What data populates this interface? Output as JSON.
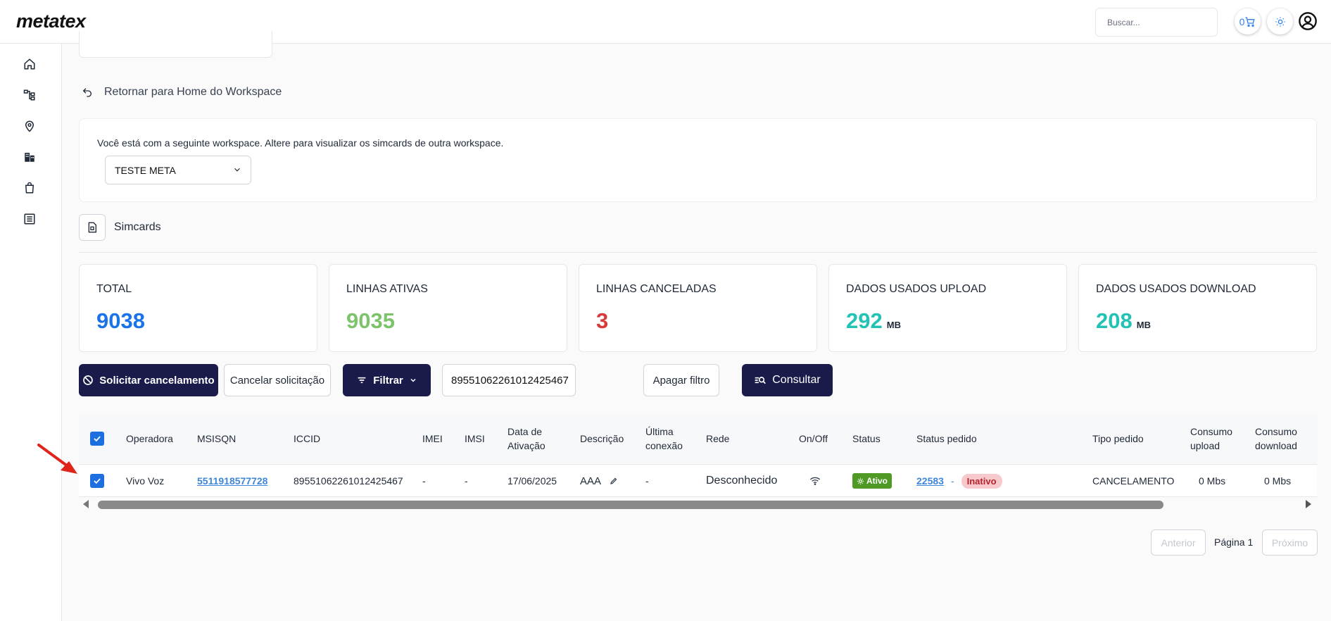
{
  "app": {
    "logo": "metatex"
  },
  "header": {
    "search_placeholder": "Buscar...",
    "cart_count": "0"
  },
  "sidebar": {
    "items": [
      {
        "icon": "home-icon"
      },
      {
        "icon": "hierarchy-icon"
      },
      {
        "icon": "location-pin-icon"
      },
      {
        "icon": "building-icon"
      },
      {
        "icon": "shopping-bag-icon"
      },
      {
        "icon": "list-icon"
      }
    ]
  },
  "nav": {
    "back_label": "Retornar para Home do Workspace"
  },
  "workspace": {
    "info_text": "Você está com a seguinte workspace. Altere para visualizar os simcards de outra workspace.",
    "selected": "TESTE META"
  },
  "section": {
    "title": "Simcards"
  },
  "stats": [
    {
      "label": "TOTAL",
      "value": "9038",
      "unit": "",
      "color": "#1a73e8"
    },
    {
      "label": "LINHAS ATIVAS",
      "value": "9035",
      "unit": "",
      "color": "#7dc36b"
    },
    {
      "label": "LINHAS CANCELADAS",
      "value": "3",
      "unit": "",
      "color": "#d63a3a"
    },
    {
      "label": "DADOS USADOS UPLOAD",
      "value": "292",
      "unit": "MB",
      "color": "#22c3b5"
    },
    {
      "label": "DADOS USADOS DOWNLOAD",
      "value": "208",
      "unit": "MB",
      "color": "#22c3b5"
    }
  ],
  "toolbar": {
    "request_cancel": "Solicitar cancelamento",
    "cancel_request": "Cancelar solicitação",
    "filter": "Filtrar",
    "iccid_value": "89551062261012425467",
    "clear_filter": "Apagar filtro",
    "query": "Consultar"
  },
  "table": {
    "headers": {
      "operadora": "Operadora",
      "msisdn": "MSISQN",
      "iccid": "ICCID",
      "imei": "IMEI",
      "imsi": "IMSI",
      "data_ativacao_1": "Data de",
      "data_ativacao_2": "Ativação",
      "descricao": "Descrição",
      "ultima_1": "Última",
      "ultima_2": "conexão",
      "rede": "Rede",
      "onoff": "On/Off",
      "status": "Status",
      "status_pedido": "Status pedido",
      "tipo_pedido": "Tipo pedido",
      "consumo_up_1": "Consumo",
      "consumo_up_2": "upload",
      "consumo_down_1": "Consumo",
      "consumo_down_2": "download"
    },
    "rows": [
      {
        "operadora": "Vivo Voz",
        "msisdn": "5511918577728",
        "iccid": "89551062261012425467",
        "imei": "-",
        "imsi": "-",
        "data_ativacao": "17/06/2025",
        "descricao": "AAA",
        "ultima_conexao": "-",
        "rede": "Desconhecido",
        "status": "Ativo",
        "pedido_id": "22583",
        "pedido_sep": "-",
        "pedido_status": "Inativo",
        "tipo_pedido": "CANCELAMENTO",
        "consumo_upload": "0 Mbs",
        "consumo_download": "0 Mbs"
      }
    ]
  },
  "pagination": {
    "prev": "Anterior",
    "page_label": "Página 1",
    "next": "Próximo"
  },
  "colors": {
    "primary_dark": "#1a1a4b",
    "checkbox": "#1d6fe0",
    "annotation_arrow": "#e0241b"
  }
}
